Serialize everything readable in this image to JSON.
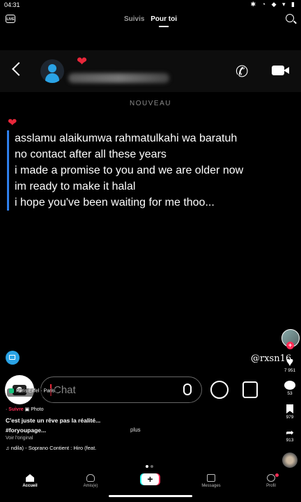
{
  "status_bar": {
    "time": "04:31",
    "icons": "✱ ◔ ◆ ▾ ▮"
  },
  "top_nav": {
    "live_label": "LIVE",
    "tabs": [
      {
        "label": "Suivis",
        "active": false
      },
      {
        "label": "Pour toi",
        "active": true
      }
    ]
  },
  "snap_chat": {
    "header_emoji": "❤",
    "divider_label": "NOUVEAU",
    "message_emoji": "❤",
    "message_lines": [
      "asslamu alaikumwa rahmatulkahi wa baratuh",
      "no contact after all these years",
      "i made a promise to you and we are older now",
      "im ready to make it halal",
      "i hope you've been waiting for me thoo..."
    ],
    "handle": "@rxsn16",
    "chat_placeholder": "Chat"
  },
  "video_overlay": {
    "location": "Paris Eiffel · Paris",
    "suivre_label": "Suivre",
    "photo_label": "Photo",
    "caption": "C'est juste un rêve pas la réalité...",
    "hashtags": "#foryoupage...",
    "plus_label": "plus",
    "voir_label": "Voir l'original",
    "music": "♫ ndila) - Soprano    Contient : Hiro (feat."
  },
  "side_actions": {
    "likes": "7 951",
    "comments": "53",
    "saves": "979",
    "shares": "913"
  },
  "bottom_nav": {
    "items": [
      {
        "label": "Accueil",
        "active": true
      },
      {
        "label": "Amis(e)",
        "active": false
      },
      {
        "label": "Messages",
        "active": false
      },
      {
        "label": "Profil",
        "active": false
      }
    ],
    "create_label": "+"
  }
}
